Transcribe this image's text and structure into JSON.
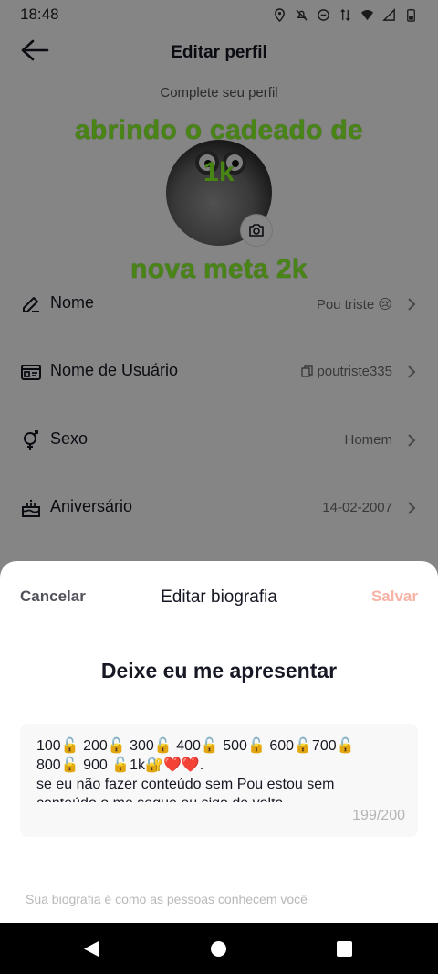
{
  "status_bar": {
    "time": "18:48"
  },
  "header": {
    "title": "Editar perfil"
  },
  "profile": {
    "complete_text": "Complete seu perfil"
  },
  "overlay": {
    "line1": "abrindo o cadeado de",
    "line2": "1k",
    "line3": "nova meta 2k"
  },
  "rows": [
    {
      "label": "Nome",
      "value": "Pou triste 😢",
      "icon": "pencil-icon"
    },
    {
      "label": "Nome de Usuário",
      "value": "poutriste335",
      "icon": "id-card-icon"
    },
    {
      "label": "Sexo",
      "value": "Homem",
      "icon": "gender-icon"
    },
    {
      "label": "Aniversário",
      "value": "14-02-2007",
      "icon": "cake-icon"
    }
  ],
  "sheet": {
    "cancel": "Cancelar",
    "title": "Editar biografia",
    "save": "Salvar",
    "heading": "Deixe eu me apresentar",
    "bio": "100🔓 200🔓 300🔓 400🔓 500🔓 600🔓700🔓\n800🔓 900 🔓1k🔐❤️❤️.\nse eu não fazer conteúdo sem Pou estou sem\nconteúdo o me segue eu sigo de volta",
    "counter": "199/200",
    "hint": "Sua biografia é como as pessoas conhecem você"
  },
  "colors": {
    "overlay_text": "#8dff2a",
    "save_disabled": "#f7b3a5"
  }
}
